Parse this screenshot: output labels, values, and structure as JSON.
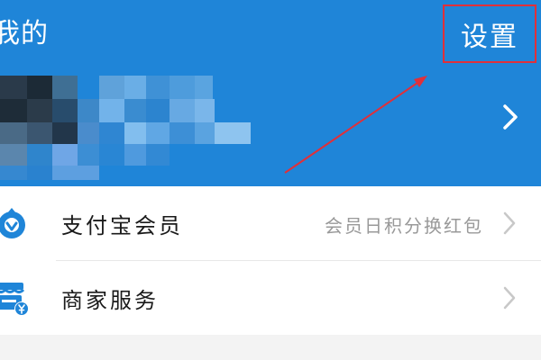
{
  "header": {
    "title": "我的",
    "settings_label": "设置",
    "background_color": "#1f85d8",
    "highlight_color": "#e0303a"
  },
  "profile": {
    "avatar_icon": "pixelated-avatar",
    "chevron_icon": "chevron-right-icon"
  },
  "menu": {
    "items": [
      {
        "label": "支付宝会员",
        "hint": "会员日积分换红包",
        "icon": "member-badge-icon"
      },
      {
        "label": "商家服务",
        "hint": "",
        "icon": "merchant-store-icon"
      }
    ]
  }
}
